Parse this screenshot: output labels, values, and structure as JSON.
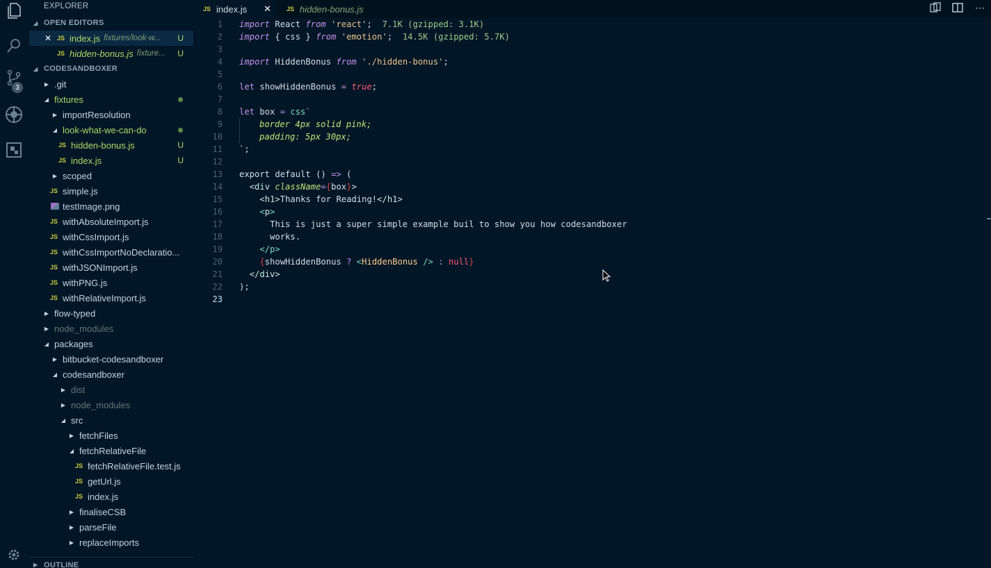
{
  "activity_bar": {
    "icons": [
      "files-icon",
      "search-icon",
      "source-control-icon",
      "debug-icon",
      "extensions-icon",
      "gear-icon"
    ],
    "scm_badge": "3"
  },
  "sidebar": {
    "title": "EXPLORER",
    "open_editors_label": "OPEN EDITORS",
    "open_editors": [
      {
        "name": "index.js",
        "desc": "fixtures/look-w...",
        "status": "U"
      },
      {
        "name": "hidden-bonus.js",
        "desc": "fixture...",
        "status": "U"
      }
    ],
    "project_label": "CODESANDBOXER",
    "tree": [
      {
        "name": ".git",
        "type": "folder"
      },
      {
        "name": "fixtures",
        "type": "folder-open"
      },
      {
        "name": "importResolution",
        "type": "folder"
      },
      {
        "name": "look-what-we-can-do",
        "type": "folder-open"
      },
      {
        "name": "hidden-bonus.js",
        "type": "file",
        "status": "U"
      },
      {
        "name": "index.js",
        "type": "file",
        "status": "U"
      },
      {
        "name": "scoped",
        "type": "folder"
      },
      {
        "name": "simple.js",
        "type": "file"
      },
      {
        "name": "testImage.png",
        "type": "image"
      },
      {
        "name": "withAbsoluteImport.js",
        "type": "file"
      },
      {
        "name": "withCssImport.js",
        "type": "file"
      },
      {
        "name": "withCssImportNoDeclaratio...",
        "type": "file"
      },
      {
        "name": "withJSONImport.js",
        "type": "file"
      },
      {
        "name": "withPNG.js",
        "type": "file"
      },
      {
        "name": "withRelativeImport.js",
        "type": "file"
      },
      {
        "name": "flow-typed",
        "type": "folder"
      },
      {
        "name": "node_modules",
        "type": "folder"
      },
      {
        "name": "packages",
        "type": "folder-open"
      },
      {
        "name": "bitbucket-codesandboxer",
        "type": "folder"
      },
      {
        "name": "codesandboxer",
        "type": "folder-open"
      },
      {
        "name": "dist",
        "type": "folder"
      },
      {
        "name": "node_modules",
        "type": "folder"
      },
      {
        "name": "src",
        "type": "folder-open"
      },
      {
        "name": "fetchFiles",
        "type": "folder"
      },
      {
        "name": "fetchRelativeFile",
        "type": "folder-open"
      },
      {
        "name": "fetchRelativeFile.test.js",
        "type": "file"
      },
      {
        "name": "getUrl.js",
        "type": "file"
      },
      {
        "name": "index.js",
        "type": "file"
      },
      {
        "name": "finaliseCSB",
        "type": "folder"
      },
      {
        "name": "parseFile",
        "type": "folder"
      },
      {
        "name": "replaceImports",
        "type": "folder"
      }
    ],
    "outline_label": "OUTLINE"
  },
  "tabs": [
    {
      "label": "index.js",
      "icon": "JS"
    },
    {
      "label": "hidden-bonus.js",
      "icon": "JS"
    }
  ],
  "editor": {
    "line_numbers": [
      "1",
      "2",
      "3",
      "4",
      "5",
      "6",
      "7",
      "8",
      "9",
      "10",
      "11",
      "12",
      "13",
      "14",
      "15",
      "16",
      "17",
      "18",
      "19",
      "20",
      "21",
      "22",
      "23"
    ],
    "tokens": {
      "l1_import": "import",
      "l1_react": " React ",
      "l1_from": "from",
      "l1_str": " 'react'",
      "l1_semi": ";",
      "l1_size": "  7.1K (gzipped: 3.1K)",
      "l2_import": "import",
      "l2_css": " { css } ",
      "l2_from": "from",
      "l2_str": " 'emotion'",
      "l2_semi": ";",
      "l2_size": "  14.5K (gzipped: 5.7K)",
      "l4_import": "import",
      "l4_hb": " HiddenBonus ",
      "l4_from": "from",
      "l4_str": " './hidden-bonus'",
      "l4_semi": ";",
      "l6_let": "let",
      "l6_var": " showHiddenBonus ",
      "l6_eq": "=",
      "l6_true": " true",
      "l6_semi": ";",
      "l8_let": "let",
      "l8_var": " box ",
      "l8_eq": "=",
      "l8_css": " css`",
      "l9": "border 4px solid pink;",
      "l10": "padding: 5px 30px;",
      "l11": "`;",
      "l13_export": "export default",
      "l13_rest": " () ",
      "l13_arrow": "=>",
      "l13_paren": " (",
      "l14_open": "<",
      "l14_tag": "div",
      "l14_attr": " className",
      "l14_eq": "=",
      "l14_lb": "{",
      "l14_val": "box",
      "l14_rb": "}",
      "l14_close": ">",
      "l15_open": "<",
      "l15_tag": "h1",
      "l15_close": ">",
      "l15_text": "Thanks for Reading!",
      "l15_end": "</h1>",
      "l16_open": "<",
      "l16_tag": "p",
      "l16_close": ">",
      "l17": "This is just a super simple example buil to show you how codesandboxer",
      "l18": "works.",
      "l19": "</p>",
      "l20_lb": "{",
      "l20_var": "showHiddenBonus ",
      "l20_q": "?",
      "l20_open": " <",
      "l20_comp": "HiddenBonus",
      "l20_close": " />",
      "l20_colon": " :",
      "l20_null": " null",
      "l20_rb": "}",
      "l21": "</div>",
      "l22": ");"
    }
  }
}
